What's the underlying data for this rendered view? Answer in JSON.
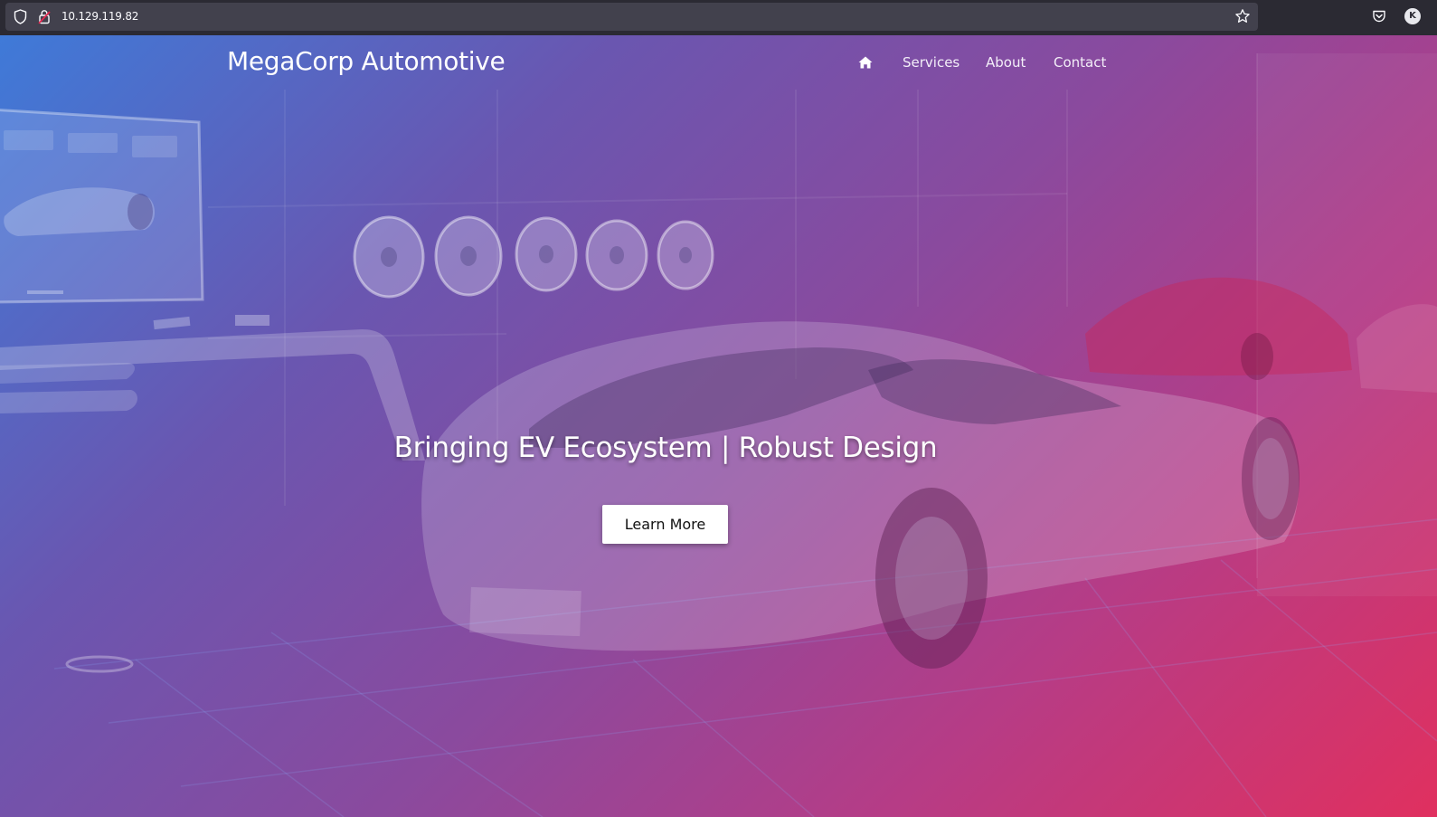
{
  "browser": {
    "url": "10.129.119.82",
    "account_initial": "K",
    "icons": [
      "shield-icon",
      "lock-icon",
      "star-icon",
      "pocket-icon"
    ]
  },
  "site": {
    "brand": "MegaCorp Automotive",
    "nav": {
      "home_icon": "home-icon",
      "services": "Services",
      "about": "About",
      "contact": "Contact"
    },
    "hero": {
      "title": "Bringing EV Ecosystem | Robust Design",
      "cta": "Learn More"
    }
  },
  "colors": {
    "gradient_start": "#3f7ad8",
    "gradient_end": "#e0305f",
    "chrome_bg": "#2b2a33",
    "urlbar_bg": "#42414d"
  }
}
